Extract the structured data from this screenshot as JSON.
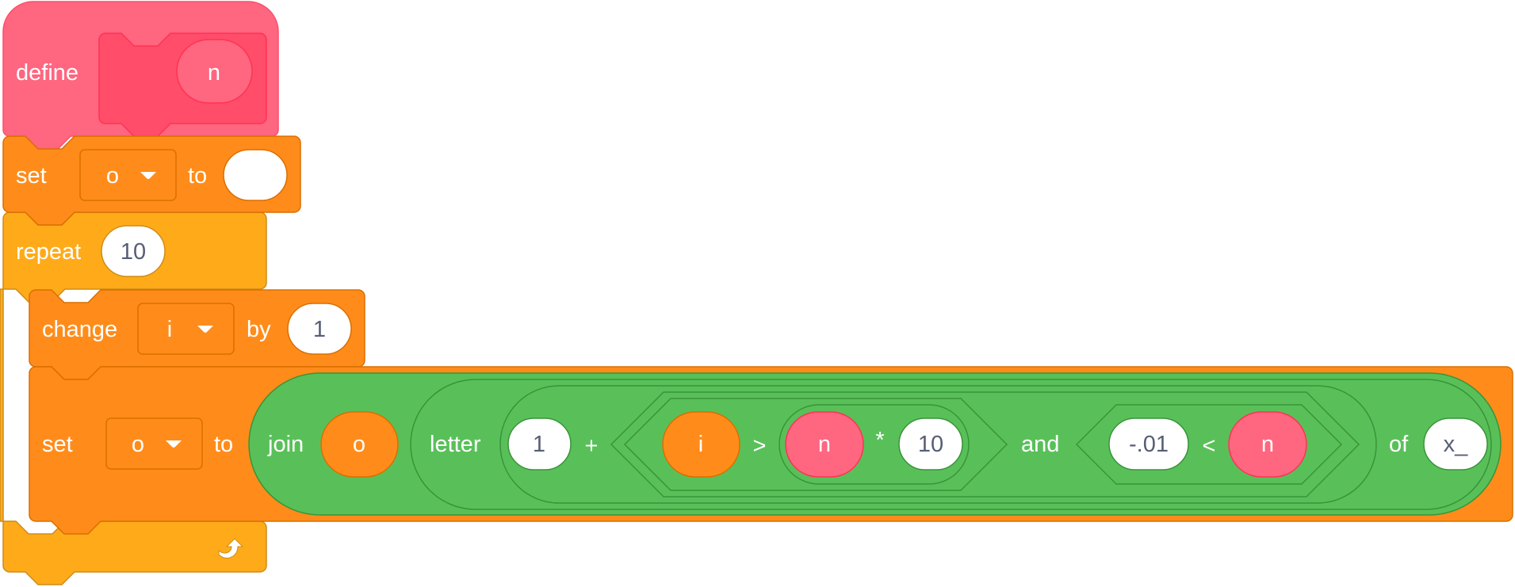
{
  "colors": {
    "custom_block": "#ff6680",
    "custom_block_dark": "#ff4d6a",
    "custom_block_border": "#ff3355",
    "variables": "#ff8c1a",
    "variables_border": "#db6e00",
    "control": "#ffab19",
    "control_border": "#cf8b17",
    "operators": "#59c059",
    "operators_border": "#389438",
    "input_text": "#575e75"
  },
  "define_block": {
    "label": "define",
    "param": "n"
  },
  "set_block_1": {
    "label": "set",
    "variable": "o",
    "to_label": "to",
    "value": ""
  },
  "repeat_block": {
    "label": "repeat",
    "times": "10",
    "loop_icon": "loop-arrow-icon"
  },
  "change_block": {
    "label": "change",
    "variable": "i",
    "by_label": "by",
    "value": "1"
  },
  "set_block_2": {
    "label": "set",
    "variable": "o",
    "to_label": "to",
    "join": {
      "label": "join",
      "first": "o",
      "letter": {
        "label": "letter",
        "of_label": "of",
        "string": "x_",
        "add": {
          "left": "1",
          "operator": "+",
          "and": {
            "label": "and",
            "gt": {
              "left": "i",
              "operator": ">",
              "mul": {
                "left": "n",
                "operator": "*",
                "right": "10"
              }
            },
            "lt": {
              "left": "-.01",
              "operator": "<",
              "right": "n"
            }
          }
        }
      }
    }
  },
  "icons": {
    "dropdown": "dropdown-arrow-icon",
    "loop": "loop-arrow-icon"
  }
}
